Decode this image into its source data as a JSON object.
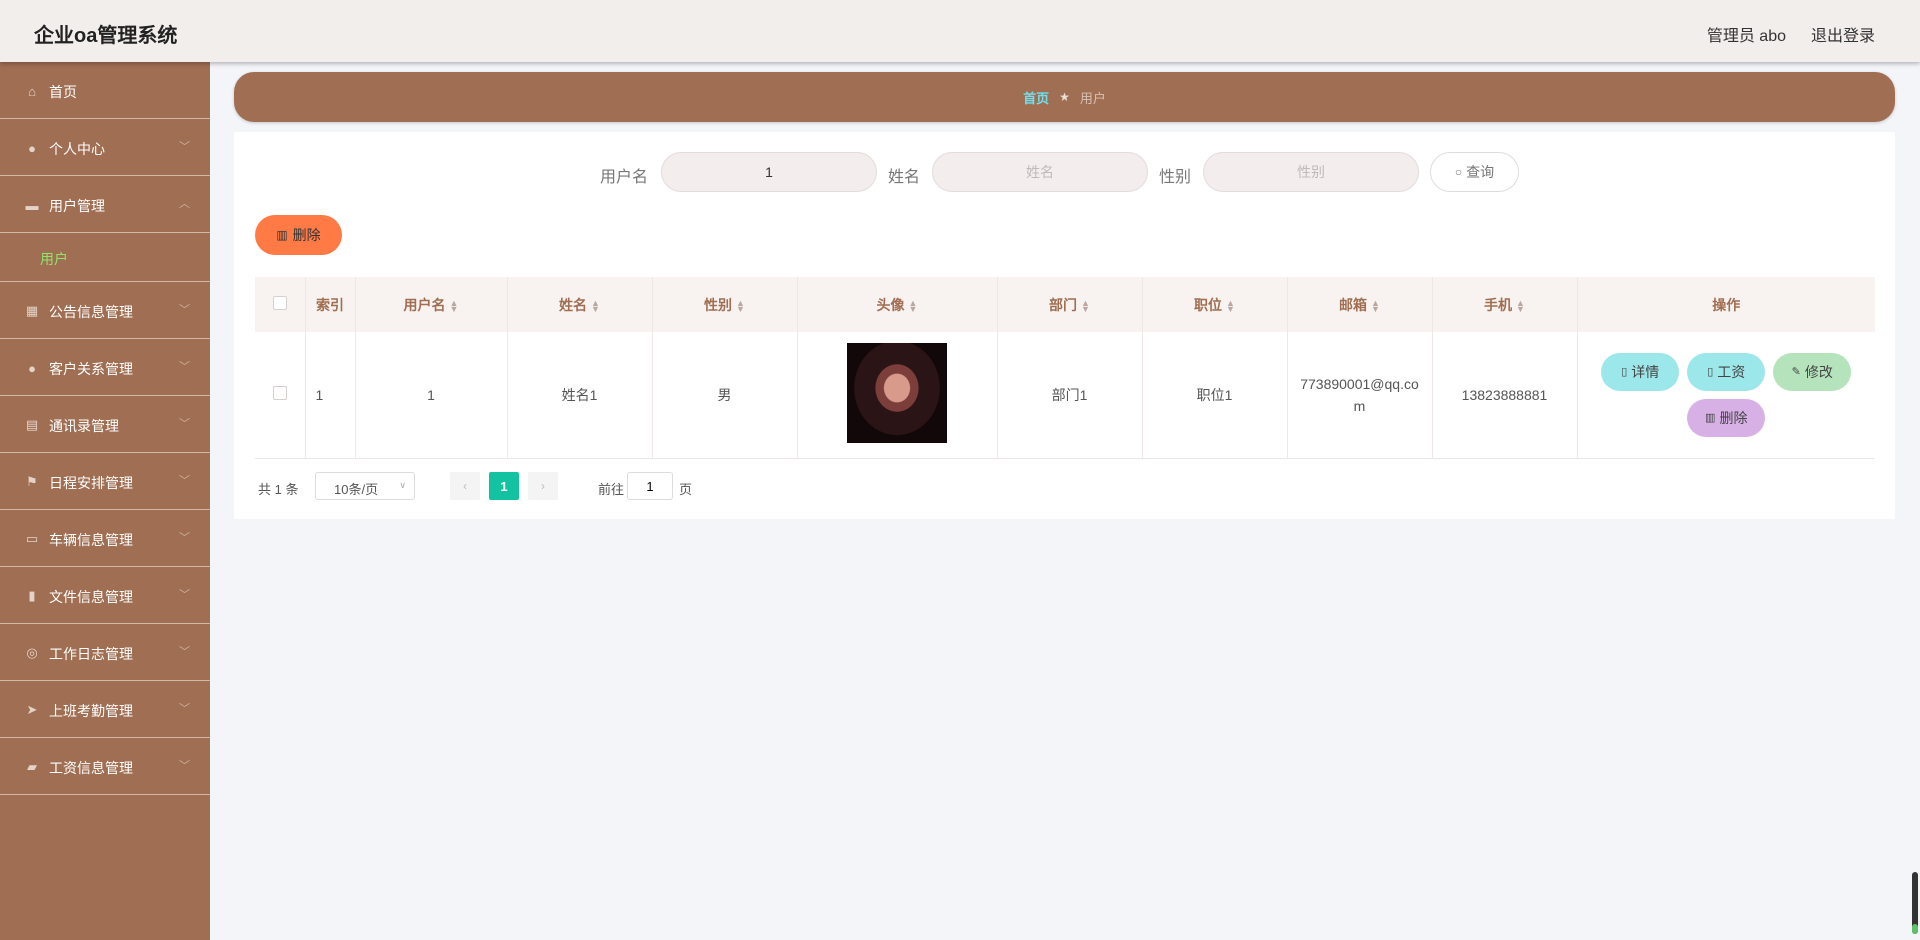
{
  "header": {
    "title": "企业oa管理系统",
    "user": "管理员 abo",
    "logout": "退出登录"
  },
  "sidebar": {
    "items": [
      {
        "label": "首页",
        "icon": "home-icon"
      },
      {
        "label": "个人中心",
        "icon": "person-icon"
      },
      {
        "label": "用户管理",
        "icon": "user-mgmt-icon",
        "expanded": true,
        "children": [
          {
            "label": "用户"
          }
        ]
      },
      {
        "label": "公告信息管理",
        "icon": "grid-icon"
      },
      {
        "label": "客户关系管理",
        "icon": "person-icon"
      },
      {
        "label": "通讯录管理",
        "icon": "briefcase-icon"
      },
      {
        "label": "日程安排管理",
        "icon": "flag-icon"
      },
      {
        "label": "车辆信息管理",
        "icon": "chat-icon"
      },
      {
        "label": "文件信息管理",
        "icon": "clipboard-icon"
      },
      {
        "label": "工作日志管理",
        "icon": "compass-icon"
      },
      {
        "label": "上班考勤管理",
        "icon": "send-icon"
      },
      {
        "label": "工资信息管理",
        "icon": "ticket-icon"
      }
    ],
    "active_sub_color": "#8ee66a"
  },
  "breadcrumb": {
    "home": "首页",
    "current": "用户"
  },
  "search": {
    "username_label": "用户名",
    "username_value": "1",
    "name_label": "姓名",
    "name_placeholder": "姓名",
    "gender_label": "性别",
    "gender_placeholder": "性别",
    "query_label": "查询"
  },
  "actions": {
    "delete_label": "删除"
  },
  "table": {
    "columns": [
      "索引",
      "用户名",
      "姓名",
      "性别",
      "头像",
      "部门",
      "职位",
      "邮箱",
      "手机",
      "操作"
    ],
    "rows": [
      {
        "index": "1",
        "username": "1",
        "name": "姓名1",
        "gender": "男",
        "department": "部门1",
        "position": "职位1",
        "email": "773890001@qq.com",
        "phone": "13823888881",
        "ops": {
          "detail": "详情",
          "salary": "工资",
          "edit": "修改",
          "remove": "删除"
        }
      }
    ]
  },
  "pagination": {
    "total": "共 1 条",
    "page_size": "10条/页",
    "current_page": "1",
    "goto_label": "前往",
    "goto_value": "1",
    "page_suffix": "页"
  },
  "colors": {
    "brand": "#a06e52",
    "danger_button": "#ff7a45",
    "page_active": "#13c2a0"
  }
}
